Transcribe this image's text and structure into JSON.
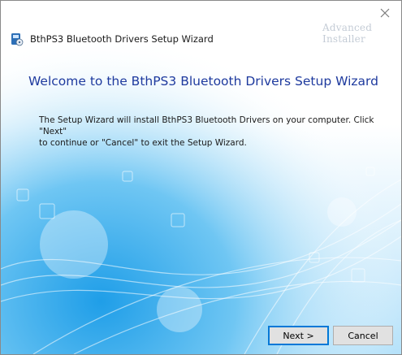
{
  "window": {
    "title": "BthPS3 Bluetooth Drivers Setup Wizard",
    "watermark": "Advanced Installer",
    "close_icon": "close-icon",
    "app_icon": "setup-installer-icon"
  },
  "main": {
    "heading": "Welcome to the BthPS3 Bluetooth Drivers Setup Wizard",
    "description": "The Setup Wizard will install BthPS3 Bluetooth Drivers on your computer.  Click \"Next\"\nto continue or \"Cancel\" to exit the Setup Wizard."
  },
  "buttons": {
    "next_label": "Next >",
    "cancel_label": "Cancel"
  },
  "colors": {
    "heading": "#1e3a9e",
    "accent_focus": "#0078d7",
    "background_art": "#29a7ee"
  }
}
